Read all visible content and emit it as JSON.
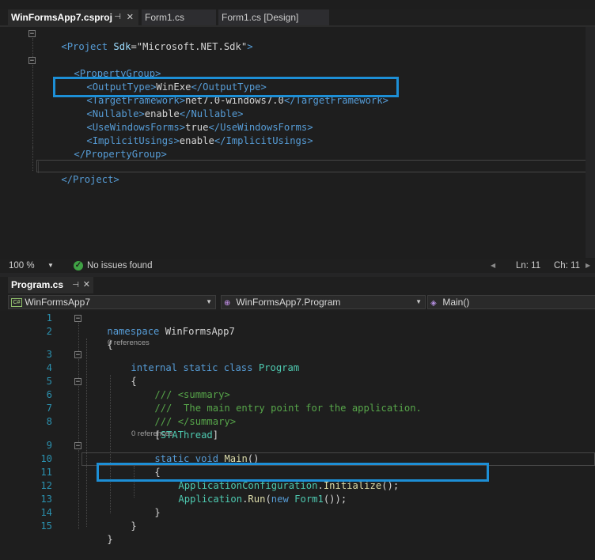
{
  "top_tabs": [
    {
      "label": "WinFormsApp7.csproj",
      "active": true
    },
    {
      "label": "Form1.cs",
      "active": false
    },
    {
      "label": "Form1.cs [Design]",
      "active": false
    }
  ],
  "glyphs": {
    "pin": "⊣",
    "close": "✕",
    "fold": "−",
    "dropdown": "▼",
    "check": "✓",
    "scroll_left": "◀",
    "scroll_right": "▶"
  },
  "csproj_lines": [
    [
      "<",
      "Project",
      " Sdk",
      "=\"Microsoft.NET.Sdk\"",
      ">"
    ],
    [],
    [
      "<",
      "PropertyGroup",
      ">"
    ],
    [
      "<",
      "OutputType",
      ">",
      "WinExe",
      "</",
      "OutputType",
      ">"
    ],
    [
      "<",
      "TargetFramework",
      ">",
      "net7.0-windows7.0",
      "</",
      "TargetFramework",
      ">"
    ],
    [
      "<",
      "Nullable",
      ">",
      "enable",
      "</",
      "Nullable",
      ">"
    ],
    [
      "<",
      "UseWindowsForms",
      ">",
      "true",
      "</",
      "UseWindowsForms",
      ">"
    ],
    [
      "<",
      "ImplicitUsings",
      ">",
      "enable",
      "</",
      "ImplicitUsings",
      ">"
    ],
    [
      "</",
      "PropertyGroup",
      ">"
    ],
    [],
    [
      "</",
      "Project",
      ">"
    ]
  ],
  "status": {
    "zoom": "100 %",
    "issues": "No issues found",
    "line": "Ln: 11",
    "col": "Ch: 11"
  },
  "bottom_tab": {
    "label": "Program.cs"
  },
  "nav": {
    "project": "WinFormsApp7",
    "project_icon": "C#",
    "class": "WinFormsApp7.Program",
    "member": "Main()"
  },
  "program": {
    "line_numbers": [
      "1",
      "2",
      "3",
      "4",
      "5",
      "6",
      "7",
      "8",
      "9",
      "10",
      "11",
      "12",
      "13",
      "14",
      "15"
    ],
    "ref_label": "0 references",
    "kw_namespace": "namespace",
    "ns_name": "WinFormsApp7",
    "brace_open": "{",
    "brace_close": "}",
    "kw_internal": "internal",
    "kw_static": "static",
    "kw_class": "class",
    "class_name": "Program",
    "comment1": "/// <summary>",
    "comment2": "///  The main entry point for the application.",
    "comment3": "/// </summary>",
    "bracket_open": "[",
    "attribute": "STAThread",
    "bracket_close": "]",
    "kw_void": "void",
    "main_name": "Main",
    "parens": "()",
    "appconfig": "ApplicationConfiguration",
    "dot": ".",
    "initialize": "Initialize",
    "call_end": "();",
    "application": "Application",
    "run": "Run",
    "paren_open": "(",
    "kw_new": "new",
    "form1": "Form1",
    "run_end": "());"
  }
}
